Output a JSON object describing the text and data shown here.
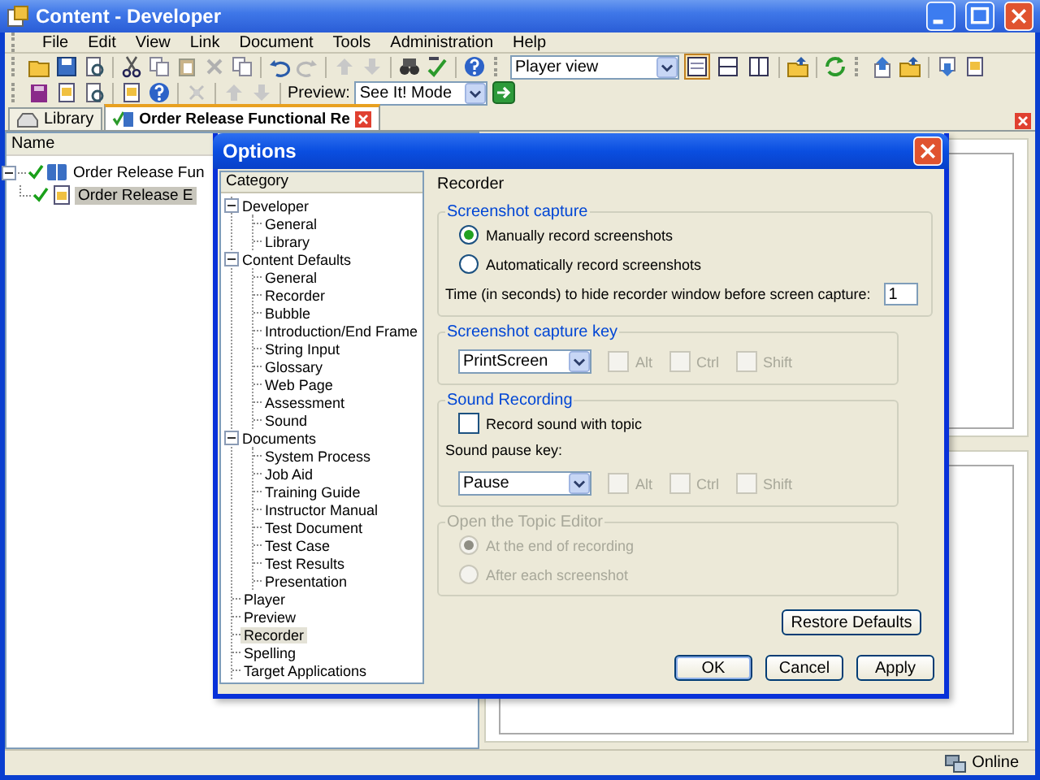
{
  "window": {
    "title": "Content - Developer"
  },
  "menu": [
    "File",
    "Edit",
    "View",
    "Link",
    "Document",
    "Tools",
    "Administration",
    "Help"
  ],
  "toolbar": {
    "view_select": "Player view",
    "view_buttons": [
      {
        "selected": true
      },
      {
        "selected": false
      },
      {
        "selected": false
      }
    ],
    "preview_label": "Preview:",
    "preview_select": "See It! Mode"
  },
  "tabs": [
    {
      "label": "Library",
      "selected": false
    },
    {
      "label": "Order Release Functional Re",
      "selected": true
    }
  ],
  "outline": {
    "column": "Name",
    "items": [
      {
        "label": "Order Release Fun",
        "checked": true,
        "selected": false,
        "expanded": true,
        "children": [
          {
            "label": "Order Release E",
            "checked": true,
            "selected": true
          }
        ]
      }
    ]
  },
  "dialog": {
    "title": "Options",
    "category_header": "Category",
    "categories": [
      {
        "label": "Developer",
        "selected": false,
        "expanded": true,
        "children": [
          {
            "label": "General",
            "selected": false
          },
          {
            "label": "Library",
            "selected": false
          }
        ]
      },
      {
        "label": "Content Defaults",
        "selected": false,
        "expanded": true,
        "children": [
          {
            "label": "General",
            "selected": false
          },
          {
            "label": "Recorder",
            "selected": false
          },
          {
            "label": "Bubble",
            "selected": false
          },
          {
            "label": "Introduction/End Frame",
            "selected": false
          },
          {
            "label": "String Input",
            "selected": false
          },
          {
            "label": "Glossary",
            "selected": false
          },
          {
            "label": "Web Page",
            "selected": false
          },
          {
            "label": "Assessment",
            "selected": false
          },
          {
            "label": "Sound",
            "selected": false
          }
        ]
      },
      {
        "label": "Documents",
        "selected": false,
        "expanded": true,
        "children": [
          {
            "label": "System Process",
            "selected": false
          },
          {
            "label": "Job Aid",
            "selected": false
          },
          {
            "label": "Training Guide",
            "selected": false
          },
          {
            "label": "Instructor Manual",
            "selected": false
          },
          {
            "label": "Test Document",
            "selected": false
          },
          {
            "label": "Test Case",
            "selected": false
          },
          {
            "label": "Test Results",
            "selected": false
          },
          {
            "label": "Presentation",
            "selected": false
          }
        ]
      },
      {
        "label": "Player",
        "selected": false
      },
      {
        "label": "Preview",
        "selected": false
      },
      {
        "label": "Recorder",
        "selected": true
      },
      {
        "label": "Spelling",
        "selected": false
      },
      {
        "label": "Target Applications",
        "selected": false
      }
    ],
    "page_title": "Recorder",
    "groups": [
      {
        "title": "Screenshot capture",
        "disabled": false,
        "rows": [
          {
            "kind": "radio",
            "label": "Manually record screenshots",
            "selected": true
          },
          {
            "kind": "radio",
            "label": "Automatically record screenshots",
            "selected": false
          },
          {
            "kind": "number",
            "label": "Time (in seconds) to hide recorder window before screen capture:",
            "value": "1"
          }
        ]
      },
      {
        "title": "Screenshot capture key",
        "disabled": false,
        "rows": [
          {
            "kind": "keycombo",
            "value": "PrintScreen",
            "modifiers": [
              {
                "label": "Alt",
                "checked": false,
                "disabled": true
              },
              {
                "label": "Ctrl",
                "checked": false,
                "disabled": true
              },
              {
                "label": "Shift",
                "checked": false,
                "disabled": true
              }
            ]
          }
        ]
      },
      {
        "title": "Sound Recording",
        "disabled": false,
        "rows": [
          {
            "kind": "checkbox",
            "label": "Record sound with topic",
            "checked": false
          },
          {
            "kind": "label",
            "label": "Sound pause key:"
          },
          {
            "kind": "keycombo",
            "value": "Pause",
            "modifiers": [
              {
                "label": "Alt",
                "checked": false,
                "disabled": true
              },
              {
                "label": "Ctrl",
                "checked": false,
                "disabled": true
              },
              {
                "label": "Shift",
                "checked": false,
                "disabled": true
              }
            ]
          }
        ]
      },
      {
        "title": "Open the Topic Editor",
        "disabled": true,
        "rows": [
          {
            "kind": "radio",
            "label": "At the end of recording",
            "selected": true
          },
          {
            "kind": "radio",
            "label": "After each screenshot",
            "selected": false
          }
        ]
      }
    ],
    "restore_button": "Restore Defaults",
    "buttons": [
      "OK",
      "Cancel",
      "Apply"
    ]
  },
  "status_bar": {
    "text": "Online"
  }
}
